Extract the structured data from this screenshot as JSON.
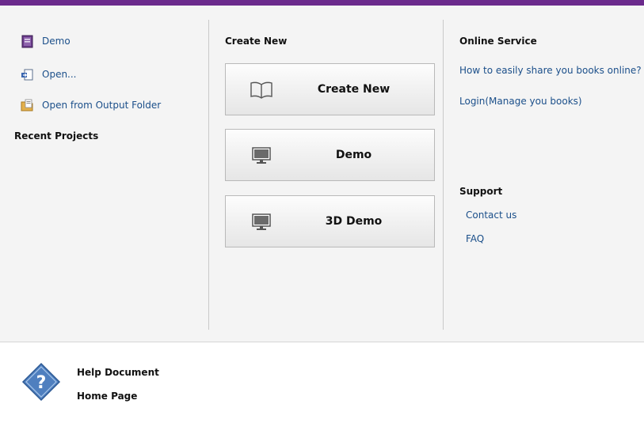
{
  "left": {
    "items": [
      {
        "label": "Demo",
        "icon": "book-icon"
      },
      {
        "label": "Open...",
        "icon": "open-icon"
      },
      {
        "label": "Open from Output Folder",
        "icon": "folder-document-icon"
      }
    ],
    "recent_title": "Recent Projects"
  },
  "center": {
    "title": "Create New",
    "buttons": [
      {
        "label": "Create New",
        "icon": "open-book-icon"
      },
      {
        "label": "Demo",
        "icon": "monitor-icon"
      },
      {
        "label": "3D Demo",
        "icon": "monitor-icon"
      }
    ]
  },
  "right": {
    "online_title": "Online Service",
    "online_links": [
      "How to easily share you books online?",
      "Login(Manage you books)"
    ],
    "support_title": "Support",
    "support_links": [
      "Contact us",
      "FAQ"
    ]
  },
  "footer": {
    "help_label": "Help Document",
    "home_label": "Home Page",
    "icon": "help-question-icon"
  },
  "colors": {
    "accent": "#6b2a8c",
    "link": "#1b4f8a",
    "help_icon": "#4f7fbf"
  }
}
